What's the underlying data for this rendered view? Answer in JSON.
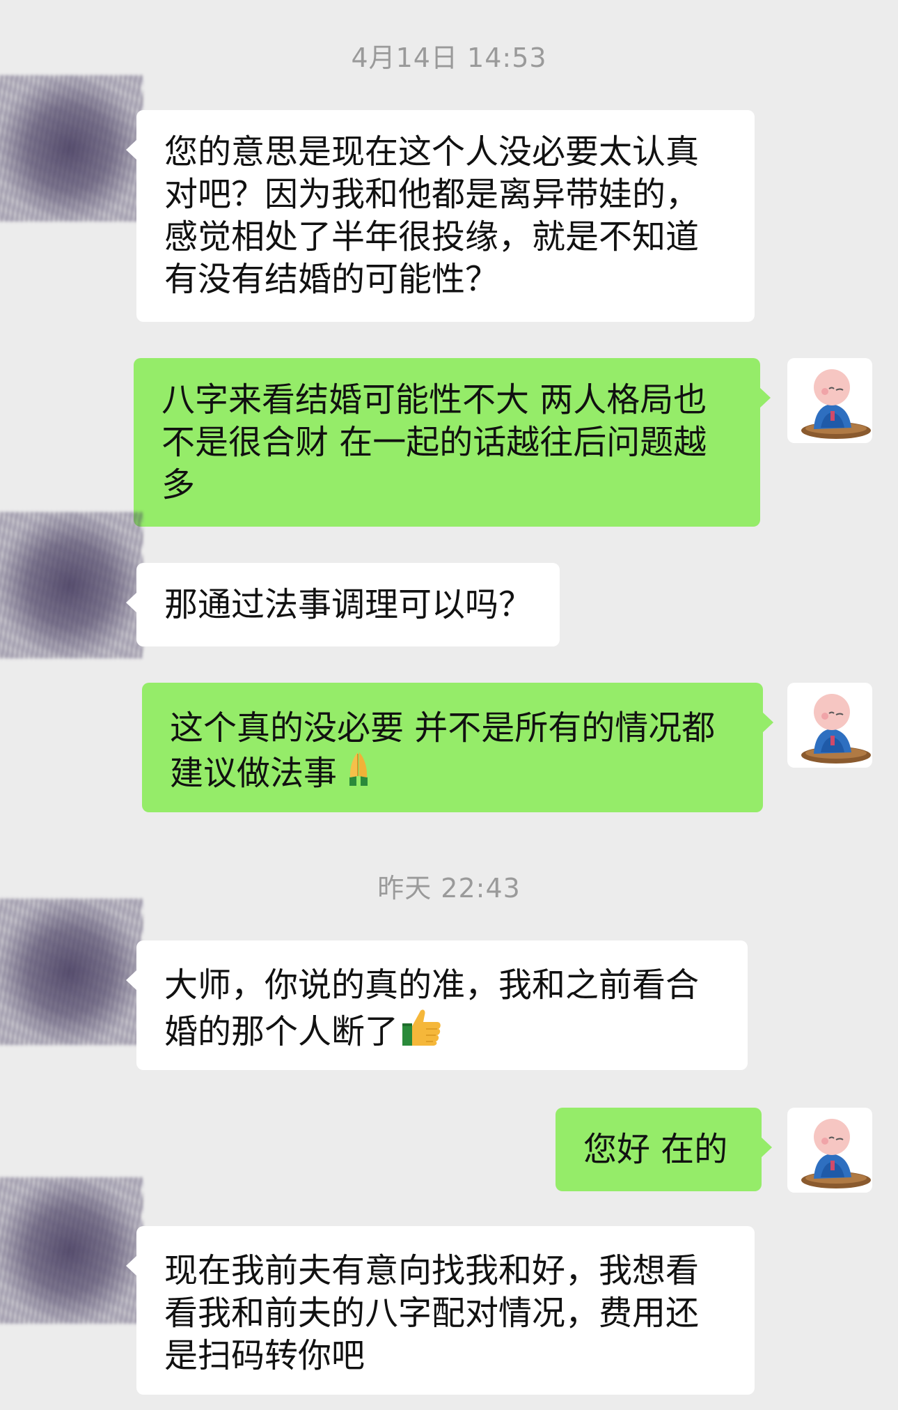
{
  "chat": {
    "timestamps": [
      "4月14日 14:53",
      "昨天 22:43"
    ],
    "messages": [
      {
        "sender": "other",
        "text": "您的意思是现在这个人没必要太认真\n对吧？因为我和他都是离异带娃的，\n感觉相处了半年很投缘，就是不知道\n有没有结婚的可能性？"
      },
      {
        "sender": "me",
        "text": "八字来看结婚可能性不大 两人格局也\n不是很合财 在一起的话越往后问题越\n多"
      },
      {
        "sender": "other",
        "text": "那通过法事调理可以吗？"
      },
      {
        "sender": "me",
        "text": "这个真的没必要 并不是所有的情况都\n建议做法事",
        "emoji": "pray-emoji"
      },
      {
        "sender": "other",
        "text": "大师，你说的真的准，我和之前看合\n婚的那个人断了",
        "emoji": "thumbs-up-emoji"
      },
      {
        "sender": "me",
        "text": "您好 在的"
      },
      {
        "sender": "other",
        "text": "现在我前夫有意向找我和好，我想看\n看我和前夫的八字配对情况，费用还\n是扫码转你吧"
      }
    ]
  },
  "colors": {
    "background": "#ececec",
    "incoming_bubble": "#ffffff",
    "outgoing_bubble": "#95ec69",
    "timestamp": "#9a9a9a"
  }
}
